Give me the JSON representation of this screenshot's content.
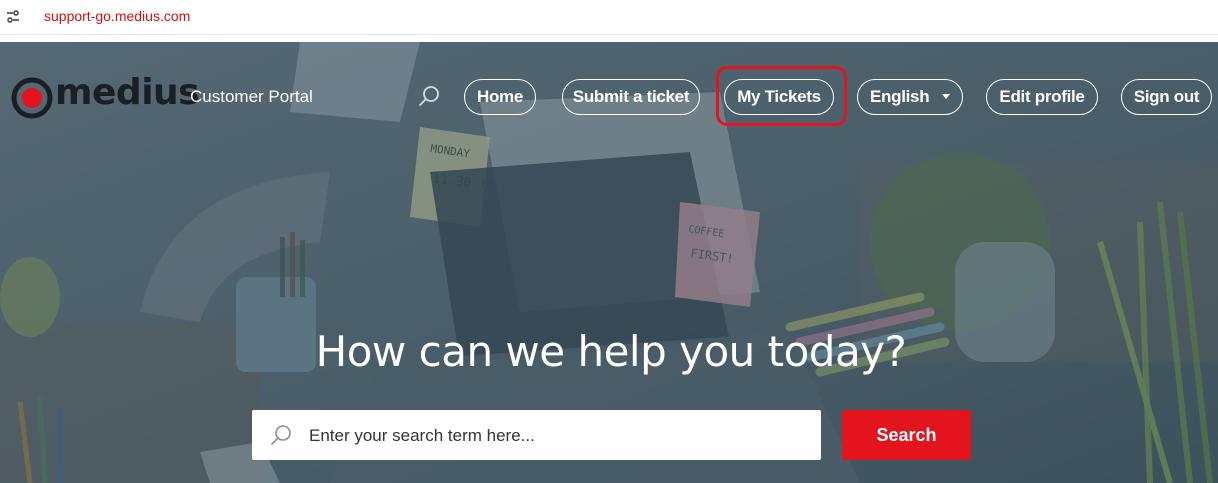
{
  "browser": {
    "url": "support-go.medius.com",
    "url_color": "#cc1111"
  },
  "header": {
    "logo_text": "medius",
    "portal_title": "Customer Portal",
    "accent_color": "#e3141d",
    "nav": {
      "search_icon": "search-icon",
      "home": "Home",
      "submit_ticket": "Submit a ticket",
      "my_tickets": "My Tickets",
      "language": "English",
      "edit_profile": "Edit profile",
      "sign_out": "Sign out"
    }
  },
  "hero": {
    "headline": "How can we help you today?",
    "search_placeholder": "Enter your search term here...",
    "search_button": "Search"
  }
}
